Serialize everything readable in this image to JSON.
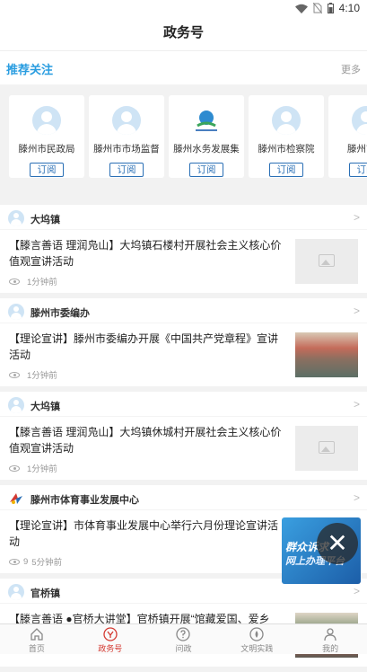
{
  "status_bar": {
    "time": "4:10"
  },
  "header": {
    "title": "政务号"
  },
  "recommend": {
    "title": "推荐关注",
    "more": "更多",
    "cards": [
      {
        "name": "滕州市民政局",
        "button": "订阅",
        "icon": "avatar-placeholder"
      },
      {
        "name": "滕州市市场监督",
        "button": "订阅",
        "icon": "avatar-placeholder"
      },
      {
        "name": "滕州水务发展集",
        "button": "订阅",
        "icon": "water-logo"
      },
      {
        "name": "滕州市检察院",
        "button": "订阅",
        "icon": "avatar-placeholder"
      },
      {
        "name": "滕州市委",
        "button": "订阅",
        "icon": "avatar-placeholder"
      }
    ]
  },
  "feed": [
    {
      "source": "大坞镇",
      "title": "【滕言善语  理润凫山】大坞镇石楼村开展社会主义核心价值观宣讲活动",
      "views": "",
      "time": "1分钟前",
      "thumb": "placeholder"
    },
    {
      "source": "滕州市委编办",
      "title": "【理论宣讲】滕州市委编办开展《中国共产党章程》宣讲活动",
      "views": "",
      "time": "1分钟前",
      "thumb": "photo"
    },
    {
      "source": "大坞镇",
      "title": "【滕言善语  理润凫山】大坞镇休城村开展社会主义核心价值观宣讲活动",
      "views": "",
      "time": "1分钟前",
      "thumb": "placeholder"
    },
    {
      "source": "滕州市体育事业发展中心",
      "title": "【理论宣讲】市体育事业发展中心举行六月份理论宣讲活动",
      "views": "9",
      "time": "5分钟前",
      "thumb": "none"
    },
    {
      "source": "官桥镇",
      "title": "【滕言善语  ●官桥大讲堂】官桥镇开展“馆藏爱国、爱乡",
      "views": "",
      "time": "",
      "thumb": "photo"
    }
  ],
  "floating_banner": {
    "line1": "群众诉求",
    "line2": "网上办理平台"
  },
  "tabbar": [
    {
      "label": "首页",
      "icon": "home-icon",
      "active": false
    },
    {
      "label": "政务号",
      "icon": "gov-badge-icon",
      "active": true
    },
    {
      "label": "问政",
      "icon": "question-icon",
      "active": false
    },
    {
      "label": "文明实践",
      "icon": "flame-icon",
      "active": false
    },
    {
      "label": "我的",
      "icon": "user-icon",
      "active": false
    }
  ],
  "colors": {
    "accent": "#2a9de0",
    "active_tab": "#d43a32",
    "subscribe": "#2a6fb5"
  }
}
